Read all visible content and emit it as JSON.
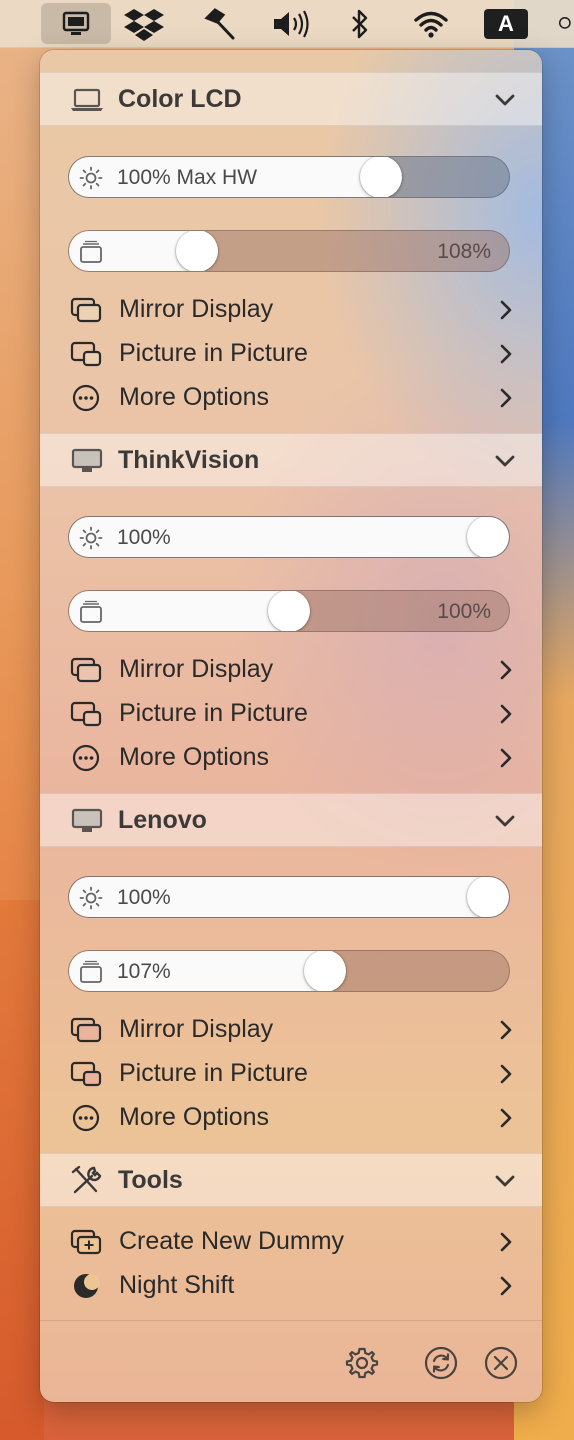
{
  "menubar": {
    "icons": [
      "display-icon",
      "dropbox-icon",
      "hammer-icon",
      "volume-icon",
      "bluetooth-icon",
      "wifi-icon",
      "input-source-icon",
      "search-icon"
    ],
    "input_source_label": "A"
  },
  "sections": [
    {
      "title": "Color LCD",
      "icon": "laptop-icon",
      "brightness": {
        "label": "100% Max HW",
        "level": 0.73
      },
      "contrast": {
        "label": "108%",
        "level": 0.27
      },
      "items": [
        {
          "label": "Mirror Display",
          "icon": "mirror-display-icon"
        },
        {
          "label": "Picture in Picture",
          "icon": "picture-in-picture-icon"
        },
        {
          "label": "More Options",
          "icon": "more-options-icon"
        }
      ]
    },
    {
      "title": "ThinkVision",
      "icon": "monitor-icon",
      "brightness": {
        "label": "100%",
        "level": 1.0
      },
      "contrast": {
        "label": "100%",
        "level": 0.5
      },
      "items": [
        {
          "label": "Mirror Display",
          "icon": "mirror-display-icon"
        },
        {
          "label": "Picture in Picture",
          "icon": "picture-in-picture-icon"
        },
        {
          "label": "More Options",
          "icon": "more-options-icon"
        }
      ]
    },
    {
      "title": "Lenovo",
      "icon": "monitor-icon",
      "brightness": {
        "label": "100%",
        "level": 1.0
      },
      "contrast": {
        "label": "107%",
        "level": 0.59
      },
      "items": [
        {
          "label": "Mirror Display",
          "icon": "mirror-display-icon"
        },
        {
          "label": "Picture in Picture",
          "icon": "picture-in-picture-icon"
        },
        {
          "label": "More Options",
          "icon": "more-options-icon"
        }
      ]
    }
  ],
  "tools": {
    "title": "Tools",
    "icon": "tools-icon",
    "items": [
      {
        "label": "Create New Dummy",
        "icon": "create-dummy-icon"
      },
      {
        "label": "Night Shift",
        "icon": "night-shift-icon"
      }
    ]
  },
  "footer": {
    "icons": [
      "settings-icon",
      "refresh-icon",
      "quit-icon"
    ]
  }
}
